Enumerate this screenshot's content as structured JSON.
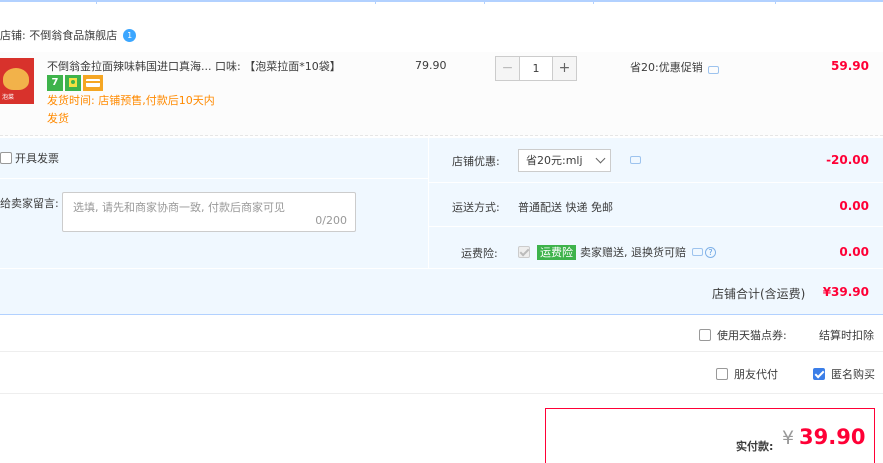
{
  "shop": {
    "label": "店铺: 不倒翁食品旗舰店",
    "badge": "1"
  },
  "item": {
    "thumb_text": "泡菜",
    "title": "不倒翁金拉面辣味韩国进口真海...",
    "flavor": "口味: 【泡菜拉面*10袋】",
    "service_icons": [
      "seven-day-return-icon",
      "guarantee-icon",
      "card-icon"
    ],
    "service_7": "7",
    "ship_note": "发货时间: 店铺预售,付款后10天内发货",
    "unit_price": "79.90",
    "quantity": "1",
    "minus": "−",
    "plus": "+",
    "promo": "省20:优惠促销",
    "subtotal": "59.90"
  },
  "options": {
    "invoice_label": "开具发票",
    "message_label": "给卖家留言:",
    "message_placeholder": "选填, 请先和商家协商一致, 付款后商家可见",
    "message_count": "0/200",
    "coupon_label": "店铺优惠:",
    "coupon_value": "省20元:mlj",
    "coupon_amount": "-20.00",
    "shipping_label": "运送方式:",
    "shipping_value": "普通配送 快递 免邮",
    "shipping_amount": "0.00",
    "insurance_label": "运费险:",
    "insurance_tag": "运费险",
    "insurance_value": "卖家赠送, 退换货可赔",
    "insurance_amount": "0.00",
    "help": "?"
  },
  "totals": {
    "shop_total_label": "店铺合计(含运费)",
    "shop_total": "¥39.90",
    "tmall_label": "使用天猫点券:",
    "tmall_note": "结算时扣除",
    "friend_pay": "朋友代付",
    "anonymous": "匿名购买",
    "pay_label": "实付款:",
    "pay_currency": "¥",
    "pay_amount": "39.90"
  },
  "colors": {
    "accent": "#ff0036",
    "blue_rule": "#b2d1ff",
    "option_bg": "#f0f8ff",
    "ship_note": "#ff8a00"
  }
}
